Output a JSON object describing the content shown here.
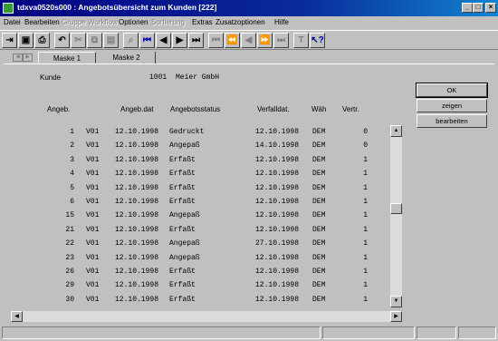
{
  "window": {
    "title": "tdxva0520s000 : Angebotsübersicht zum Kunden [222]"
  },
  "menu": [
    {
      "label": "Datei",
      "disabled": false
    },
    {
      "label": "Bearbeiten",
      "disabled": false
    },
    {
      "label": "Gruppe",
      "disabled": true
    },
    {
      "label": "Workflow",
      "disabled": true
    },
    {
      "label": "Optionen",
      "disabled": false
    },
    {
      "label": "Sortierung",
      "disabled": true
    },
    {
      "label": "Extras",
      "disabled": false
    },
    {
      "label": "Zusatzoptionen",
      "disabled": false
    },
    {
      "label": "Hilfe",
      "disabled": false
    }
  ],
  "toolbar": {
    "icons": [
      "exit-icon",
      "save-icon",
      "print-icon",
      "undo-icon",
      "copy-icon",
      "paste-icon",
      "clipboard-icon",
      "find-icon",
      "first-record-icon",
      "previous-record-icon",
      "next-record-icon",
      "last-record-icon",
      "first-group-icon",
      "previous-group-icon",
      "previous-page-icon",
      "next-page-icon",
      "last-group-icon",
      "text-icon",
      "help-pointer-icon"
    ]
  },
  "tabs": [
    {
      "label": "Maske 1",
      "active": true
    },
    {
      "label": "Maske 2",
      "active": false
    }
  ],
  "customer": {
    "label": "Kunde",
    "number": "1001",
    "name": "Meier GmbH"
  },
  "buttons": {
    "ok": "OK",
    "show": "zeigen",
    "edit": "bearbeiten"
  },
  "table": {
    "headers": [
      "Angeb.",
      "Angeb.dat",
      "Angebotsstatus",
      "Verfalldat.",
      "Wäh",
      "Vertr."
    ],
    "rows": [
      [
        "1",
        "V01",
        "12.10.1998",
        "Gedruckt",
        "12.10.1998",
        "DEM",
        "0"
      ],
      [
        "2",
        "V01",
        "12.10.1998",
        "Angepaß",
        "14.10.1998",
        "DEM",
        "0"
      ],
      [
        "3",
        "V01",
        "12.10.1998",
        "Erfaßt",
        "12.10.1998",
        "DEM",
        "1"
      ],
      [
        "4",
        "V01",
        "12.10.1998",
        "Erfaßt",
        "12.10.1998",
        "DEM",
        "1"
      ],
      [
        "5",
        "V01",
        "12.10.1998",
        "Erfaßt",
        "12.10.1998",
        "DEM",
        "1"
      ],
      [
        "6",
        "V01",
        "12.10.1998",
        "Erfaßt",
        "12.10.1998",
        "DEM",
        "1"
      ],
      [
        "15",
        "V01",
        "12.10.1998",
        "Angepaß",
        "12.10.1998",
        "DEM",
        "1"
      ],
      [
        "21",
        "V01",
        "12.10.1998",
        "Erfaßt",
        "12.10.1998",
        "DEM",
        "1"
      ],
      [
        "22",
        "V01",
        "12.10.1998",
        "Angepaß",
        "27.10.1998",
        "DEM",
        "1"
      ],
      [
        "23",
        "V01",
        "12.10.1998",
        "Angepaß",
        "12.10.1998",
        "DEM",
        "1"
      ],
      [
        "26",
        "V01",
        "12.10.1998",
        "Erfaßt",
        "12.10.1998",
        "DEM",
        "1"
      ],
      [
        "29",
        "V01",
        "12.10.1998",
        "Erfaßt",
        "12.10.1998",
        "DEM",
        "1"
      ],
      [
        "30",
        "V01",
        "12.10.1998",
        "Erfaßt",
        "12.10.1998",
        "DEM",
        "1"
      ]
    ]
  },
  "colors": {
    "titlebar": "#000080",
    "window": "#c0c0c0"
  }
}
